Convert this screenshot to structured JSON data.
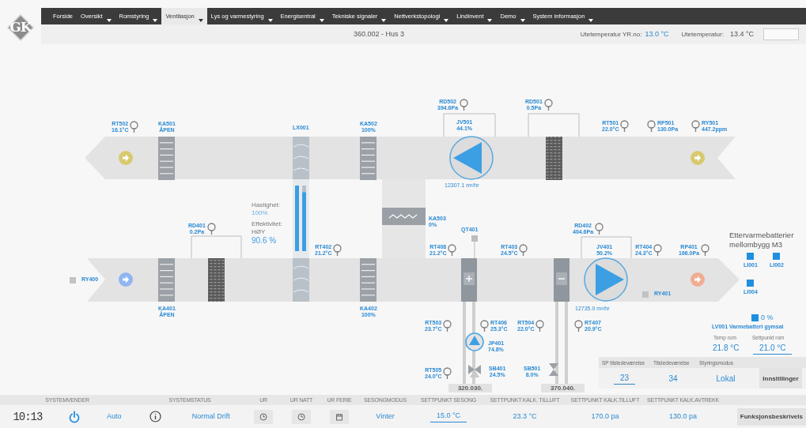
{
  "logo": "GK",
  "nav": [
    {
      "label": "Forside",
      "dropdown": false,
      "selected": false
    },
    {
      "label": "Oversikt",
      "dropdown": true,
      "selected": false
    },
    {
      "label": "Romstyring",
      "dropdown": true,
      "selected": false
    },
    {
      "label": "Ventilasjon",
      "dropdown": true,
      "selected": true
    },
    {
      "label": "Lys og varmestyring",
      "dropdown": true,
      "selected": false
    },
    {
      "label": "Energisentral",
      "dropdown": true,
      "selected": false
    },
    {
      "label": "Tekniske signaler",
      "dropdown": true,
      "selected": false
    },
    {
      "label": "Nettverkstopologi",
      "dropdown": true,
      "selected": false
    },
    {
      "label": "Lindinvent",
      "dropdown": true,
      "selected": false
    },
    {
      "label": "Demo",
      "dropdown": true,
      "selected": false
    },
    {
      "label": "System informasjon",
      "dropdown": true,
      "selected": false
    }
  ],
  "header": {
    "location": "360.002 - Hus 3",
    "yr_label": "Utetemperatur YR.no:",
    "yr_value": "13.0 °C",
    "outdoor_label": "Utetemperatur:",
    "outdoor_value": "13.4 °C"
  },
  "tags": [
    {
      "kind": "sensor",
      "name": "RT502",
      "value": "16.1°C"
    },
    {
      "kind": "label",
      "name": "KA501",
      "value": "ÅPEN"
    },
    {
      "kind": "label",
      "name": "LX001"
    },
    {
      "kind": "label",
      "name": "KA502",
      "value": "100%"
    },
    {
      "kind": "sensor",
      "name": "RD502",
      "value": "394.6Pa"
    },
    {
      "kind": "label",
      "name": "JV501",
      "value": "44.1%"
    },
    {
      "kind": "sensor",
      "name": "RD501",
      "value": "0.5Pa"
    },
    {
      "kind": "sensor",
      "name": "RT501",
      "value": "22.0°C"
    },
    {
      "kind": "sensor",
      "name": "RP501",
      "value": "130.0Pa"
    },
    {
      "kind": "sensor",
      "name": "RY501",
      "value": "447.2ppm"
    },
    {
      "kind": "flow",
      "name": "12307.1 m³/hr"
    },
    {
      "kind": "sensor",
      "name": "RD401",
      "value": "0.2Pa"
    },
    {
      "kind": "sensor",
      "name": "RT402",
      "value": "21.2°C"
    },
    {
      "kind": "label",
      "name": "KA503",
      "value": "0%"
    },
    {
      "kind": "label",
      "name": "QT401"
    },
    {
      "kind": "sensor",
      "name": "RT408",
      "value": "21.2°C"
    },
    {
      "kind": "sensor",
      "name": "RT403",
      "value": "24.5°C"
    },
    {
      "kind": "sensor",
      "name": "RD402",
      "value": "404.6Pa"
    },
    {
      "kind": "label",
      "name": "JV401",
      "value": "50.2%"
    },
    {
      "kind": "sensor",
      "name": "RT404",
      "value": "24.3°C"
    },
    {
      "kind": "sensor",
      "name": "RP401",
      "value": "166.0Pa"
    },
    {
      "kind": "indicator",
      "name": "RY400"
    },
    {
      "kind": "indicator",
      "name": "RY401"
    },
    {
      "kind": "label",
      "name": "KA401",
      "value": "ÅPEN"
    },
    {
      "kind": "label",
      "name": "KA402",
      "value": "100%"
    },
    {
      "kind": "flow",
      "name": "12735.0 m³/hr"
    },
    {
      "kind": "sensor",
      "name": "RT503",
      "value": "23.7°C"
    },
    {
      "kind": "sensor",
      "name": "RT406",
      "value": "25.3°C"
    },
    {
      "kind": "sensor",
      "name": "RT504",
      "value": "22.0°C"
    },
    {
      "kind": "sensor",
      "name": "RT407",
      "value": "20.9°C"
    },
    {
      "kind": "label",
      "name": "JP401",
      "value": "74.8%"
    },
    {
      "kind": "sensor",
      "name": "RT505",
      "value": "24.0°C"
    },
    {
      "kind": "label",
      "name": "SB401",
      "value": "24.5%"
    },
    {
      "kind": "label",
      "name": "SB501",
      "value": "8.0%"
    },
    {
      "kind": "readout",
      "name": "320.030."
    },
    {
      "kind": "readout",
      "name": "370.040."
    }
  ],
  "wheel_info": {
    "speed_label": "Hastighet:",
    "speed_value": "100%",
    "efficiency_label": "Effektivitet:",
    "efficiency_mode": "HØY",
    "efficiency_value": "90.6 %"
  },
  "wheel_bars": [
    {
      "level": 1
    },
    {
      "level": 0.9
    }
  ],
  "reheat": {
    "title": "Ettervarmebatterier mellombygg M3",
    "units": [
      {
        "name": "LI001"
      },
      {
        "name": "LI002"
      },
      {
        "name": "LI004"
      }
    ],
    "valve_value": "0 %",
    "valve_name": "LV001 Varmebatteri gymsal",
    "temp_label": "Temp rom",
    "temp_value": "21.8 °C",
    "setpoint_label": "Settpunkt rom",
    "setpoint_value": "21.0 °C"
  },
  "presence": {
    "columns": [
      {
        "heading": "SP tilstedeværelse",
        "kind": "setpoint",
        "value": "23"
      },
      {
        "heading": "Tilstedeværelse",
        "kind": "value",
        "value": "34"
      },
      {
        "heading": "Styringsmodus",
        "kind": "value",
        "value": "Lokal"
      }
    ],
    "button": "Innstillinger"
  },
  "status_bar": [
    {
      "heading": "SYSTEMVENDER",
      "items": [
        {
          "kind": "clock",
          "text": "10:13"
        },
        {
          "kind": "power"
        },
        {
          "kind": "value",
          "text": "Auto"
        }
      ]
    },
    {
      "heading": "SYSTEMSTATUS",
      "items": [
        {
          "kind": "info"
        },
        {
          "kind": "value",
          "text": "Normal Drift"
        }
      ]
    },
    {
      "heading": "UR",
      "items": [
        {
          "kind": "clock-button"
        }
      ]
    },
    {
      "heading": "UR NATT",
      "items": [
        {
          "kind": "clock-button"
        }
      ]
    },
    {
      "heading": "UR FERIE",
      "items": [
        {
          "kind": "calendar-button"
        }
      ]
    },
    {
      "heading": "SESONGMODUS",
      "items": [
        {
          "kind": "value",
          "text": "Vinter"
        }
      ]
    },
    {
      "heading": "SETTPUNKT SESONG",
      "items": [
        {
          "kind": "setpoint",
          "text": "15.0 °C"
        }
      ]
    },
    {
      "heading": "SETTPUNKT KALK. TILLUFT",
      "items": [
        {
          "kind": "value",
          "text": "23.3 °C"
        }
      ]
    },
    {
      "heading": "SETTPUNKT KALK.TILLUFT",
      "items": [
        {
          "kind": "value",
          "text": "170.0 pa"
        }
      ]
    },
    {
      "heading": "SETTPUNKT KALK.AVTREKK",
      "items": [
        {
          "kind": "value",
          "text": "130.0 pa"
        }
      ]
    },
    {
      "items": [
        {
          "kind": "button",
          "text": "Funksjonsbeskrivels"
        }
      ]
    }
  ]
}
